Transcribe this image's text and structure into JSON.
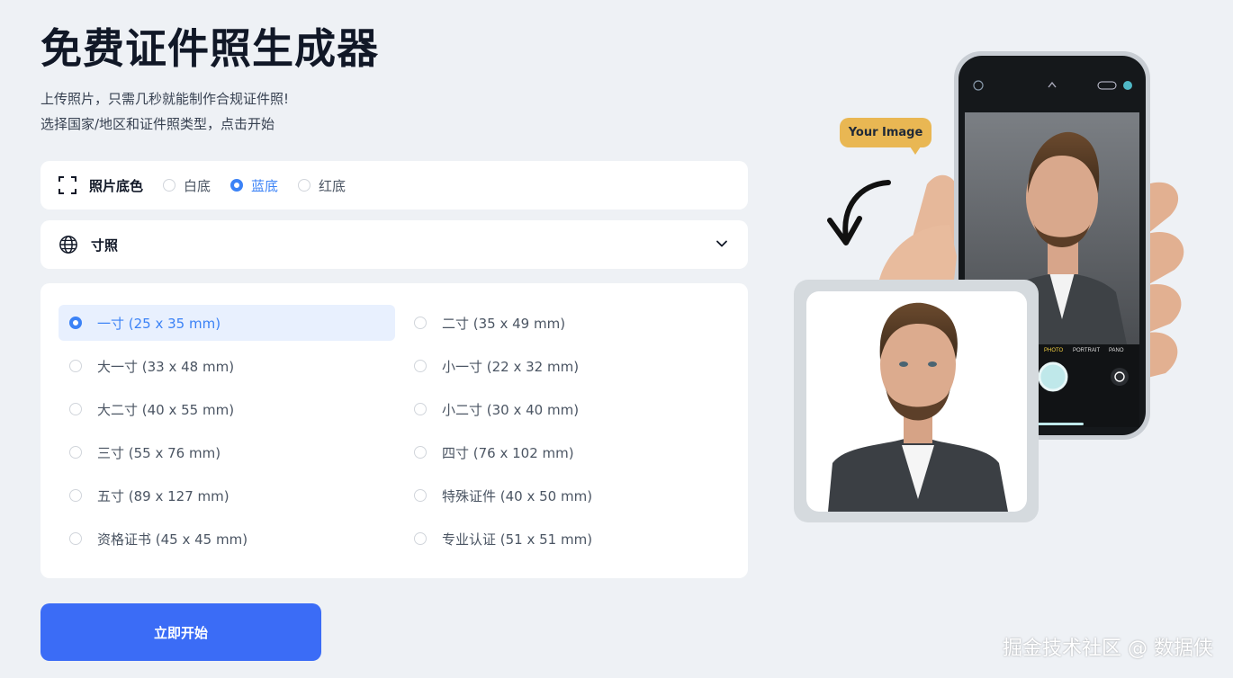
{
  "title": "免费证件照生成器",
  "subtitle_line1": "上传照片，只需几秒就能制作合规证件照!",
  "subtitle_line2": "选择国家/地区和证件照类型，点击开始",
  "background": {
    "label": "照片底色",
    "options": [
      {
        "label": "白底",
        "selected": false
      },
      {
        "label": "蓝底",
        "selected": true
      },
      {
        "label": "红底",
        "selected": false
      }
    ]
  },
  "size_select": {
    "label": "寸照"
  },
  "sizes": [
    {
      "label": "一寸 (25 x 35 mm)",
      "selected": true
    },
    {
      "label": "二寸 (35 x 49 mm)",
      "selected": false
    },
    {
      "label": "大一寸 (33 x 48 mm)",
      "selected": false
    },
    {
      "label": "小一寸 (22 x 32 mm)",
      "selected": false
    },
    {
      "label": "大二寸 (40 x 55 mm)",
      "selected": false
    },
    {
      "label": "小二寸 (30 x 40 mm)",
      "selected": false
    },
    {
      "label": "三寸 (55 x 76 mm)",
      "selected": false
    },
    {
      "label": "四寸 (76 x 102 mm)",
      "selected": false
    },
    {
      "label": "五寸 (89 x 127 mm)",
      "selected": false
    },
    {
      "label": "特殊证件 (40 x 50 mm)",
      "selected": false
    },
    {
      "label": "资格证书 (45 x 45 mm)",
      "selected": false
    },
    {
      "label": "专业认证 (51 x 51 mm)",
      "selected": false
    }
  ],
  "start_button": "立即开始",
  "illustration": {
    "bubble": "Your Image",
    "camera_modes": [
      "PHOTO",
      "PORTRAIT",
      "PANO"
    ]
  },
  "watermark": "掘金技术社区 @ 数据侠",
  "colors": {
    "accent": "#3b82f6",
    "button": "#3b6cf6",
    "bubble": "#e9b753"
  }
}
